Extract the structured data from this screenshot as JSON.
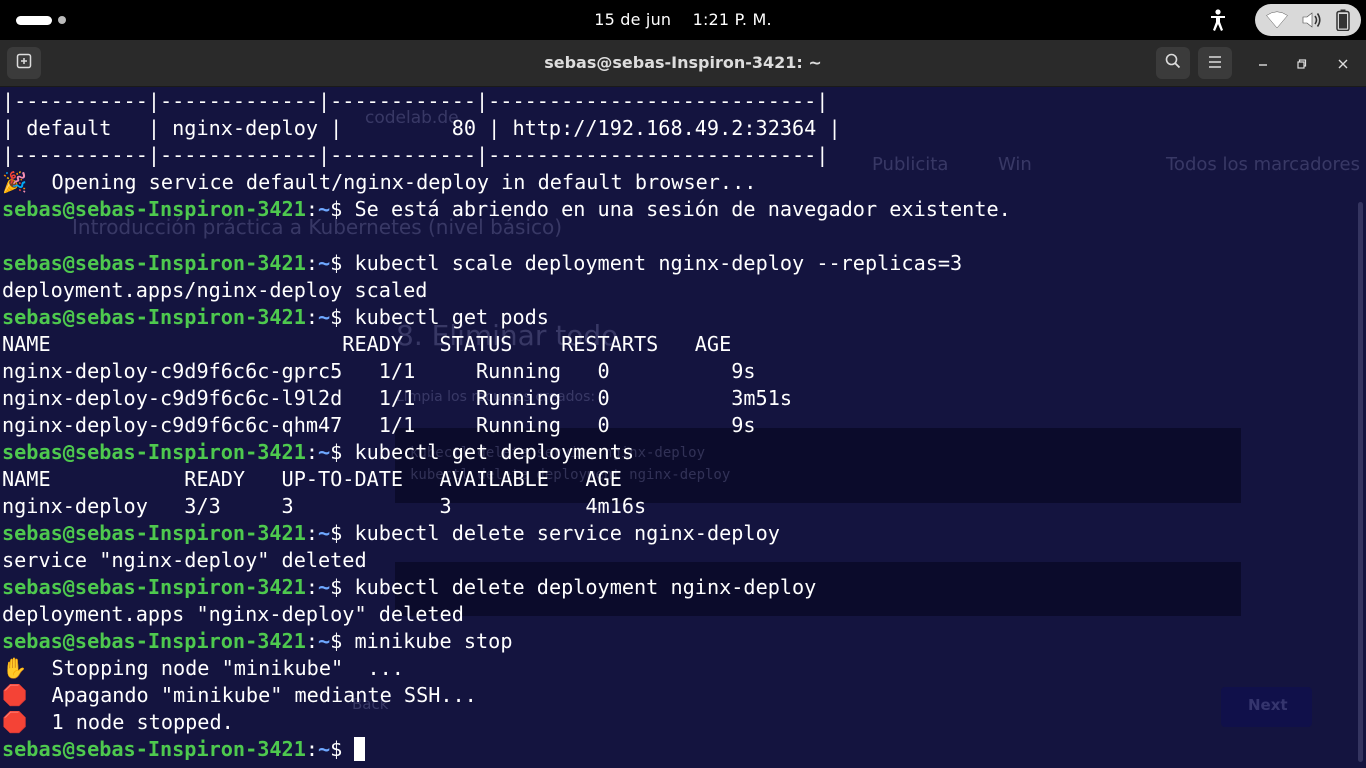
{
  "topbar": {
    "date": "15 de jun",
    "time": "1:21 P. M.",
    "icons": [
      "workspace-indicator",
      "accessibility-icon",
      "wifi-icon",
      "volume-icon",
      "battery-icon"
    ]
  },
  "window": {
    "title": "sebas@sebas-Inspiron-3421: ~",
    "icons": [
      "new-tab-icon",
      "search-icon",
      "menu-icon",
      "minimize-icon",
      "maximize-icon",
      "close-icon"
    ]
  },
  "colors": {
    "terminal_bg": "#14143f",
    "prompt_user": "#4ec94e",
    "prompt_path": "#6fa8ff",
    "text": "#ffffff"
  },
  "prompt": {
    "user": "sebas@sebas-Inspiron-3421",
    "sep": ":",
    "path": "~",
    "dollar": "$ "
  },
  "terminal": {
    "lines": [
      {
        "text": "|-----------|-------------|------------|---------------------------|"
      },
      {
        "text": "| default   | nginx-deploy |         80 | http://192.168.49.2:32364 |"
      },
      {
        "text": "|-----------|-------------|------------|---------------------------|"
      },
      {
        "emoji": "🎉",
        "text": "  Opening service default/nginx-deploy in default browser..."
      },
      {
        "prompt": true,
        "text": "Se está abriendo en una sesión de navegador existente."
      },
      {
        "text": ""
      },
      {
        "prompt": true,
        "text": "kubectl scale deployment nginx-deploy --replicas=3"
      },
      {
        "text": "deployment.apps/nginx-deploy scaled"
      },
      {
        "prompt": true,
        "text": "kubectl get pods"
      },
      {
        "text": "NAME                        READY   STATUS    RESTARTS   AGE"
      },
      {
        "text": "nginx-deploy-c9d9f6c6c-gprc5   1/1     Running   0          9s"
      },
      {
        "text": "nginx-deploy-c9d9f6c6c-l9l2d   1/1     Running   0          3m51s"
      },
      {
        "text": "nginx-deploy-c9d9f6c6c-qhm47   1/1     Running   0          9s"
      },
      {
        "prompt": true,
        "text": "kubectl get deployments"
      },
      {
        "text": "NAME           READY   UP-TO-DATE   AVAILABLE   AGE"
      },
      {
        "text": "nginx-deploy   3/3     3            3           4m16s"
      },
      {
        "prompt": true,
        "text": "kubectl delete service nginx-deploy"
      },
      {
        "text": "service \"nginx-deploy\" deleted"
      },
      {
        "prompt": true,
        "text": "kubectl delete deployment nginx-deploy"
      },
      {
        "text": "deployment.apps \"nginx-deploy\" deleted"
      },
      {
        "prompt": true,
        "text": "minikube stop"
      },
      {
        "emoji": "✋",
        "text": "  Stopping node \"minikube\"  ..."
      },
      {
        "emoji": "🛑",
        "text": "  Apagando \"minikube\" mediante SSH..."
      },
      {
        "emoji": "🛑",
        "text": "  1 node stopped."
      },
      {
        "prompt": true,
        "text": "",
        "cursor": true
      }
    ]
  },
  "background_window": {
    "tab_text": "codelab.de",
    "bookmarks": [
      "Publicita",
      "Win",
      "Todos los marcadores"
    ],
    "page_title": "Introducción práctica a Kubernetes (nivel básico)",
    "heading": "8. Eliminar todo",
    "subtext": "Limpia los recursos creados:",
    "code_line1": "kubectl delete service nginx-deploy",
    "code_line2": "kubectl delete deployment nginx-deploy",
    "back_label": "Back",
    "next_label": "Next"
  }
}
